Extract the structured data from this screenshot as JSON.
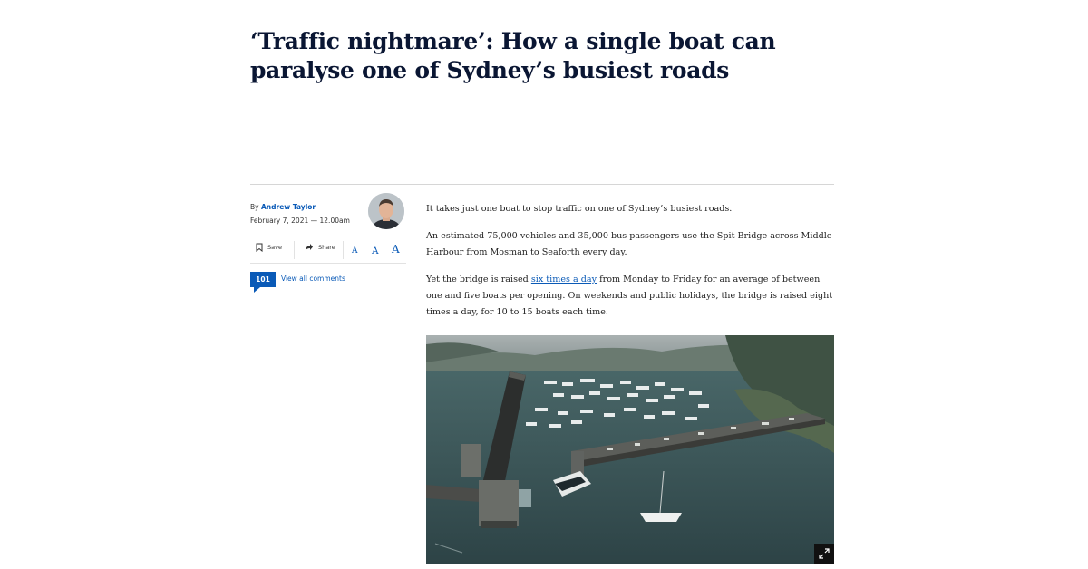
{
  "article": {
    "headline": "‘Traffic nightmare’: How a single boat can paralyse one of Sydney’s busiest roads",
    "byline_prefix": "By",
    "author": "Andrew Taylor",
    "date": "February 7, 2021 — 12.00am"
  },
  "toolbar": {
    "save_label": "Save",
    "share_label": "Share",
    "font_small": "A",
    "font_medium": "A",
    "font_large": "A"
  },
  "comments": {
    "count": "101",
    "link_label": "View all comments"
  },
  "body": {
    "p1": "It takes just one boat to stop traffic on one of Sydney’s busiest roads.",
    "p2": "An estimated 75,000 vehicles and 35,000 bus passengers use the Spit Bridge across Middle Harbour from Mosman to Seaforth every day.",
    "p3_before": "Yet the bridge is raised ",
    "p3_link": "six times a day",
    "p3_after": " from Monday to Friday for an average of between one and five boats per opening. On weekends and public holidays, the bridge is raised eight times a day, for 10 to 15 boats each time."
  },
  "icons": {
    "save": "bookmark-icon",
    "share": "share-arrow-icon",
    "expand": "expand-icon"
  },
  "colors": {
    "accent": "#0a5ab7",
    "headline": "#0a1633"
  }
}
